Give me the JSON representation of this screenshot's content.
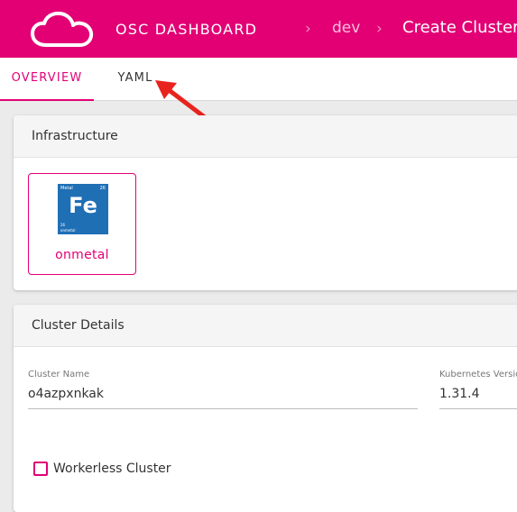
{
  "header": {
    "app_title": "OSC DASHBOARD",
    "breadcrumb_sep": "›",
    "breadcrumb_project": "dev",
    "breadcrumb_current": "Create Cluster",
    "logo_icon": "cloud-icon",
    "brand_color": "#e20074"
  },
  "tabs": {
    "overview": "OVERVIEW",
    "yaml": "YAML"
  },
  "annotation": {
    "arrow_icon": "red-arrow-icon",
    "arrow_color": "#e8231e"
  },
  "infrastructure": {
    "title": "Infrastructure",
    "provider": {
      "label": "onmetal",
      "icon": "fe-metal-element-icon",
      "icon_tag": "Metal",
      "icon_number": "26",
      "icon_symbol": "Fe",
      "icon_mass": "26",
      "icon_name": "onmetal"
    }
  },
  "cluster_details": {
    "title": "Cluster Details",
    "name_label": "Cluster Name",
    "name_value": "o4azpxnkak",
    "k8s_label": "Kubernetes Version",
    "k8s_value": "1.31.4",
    "workerless_label": "Workerless Cluster"
  }
}
